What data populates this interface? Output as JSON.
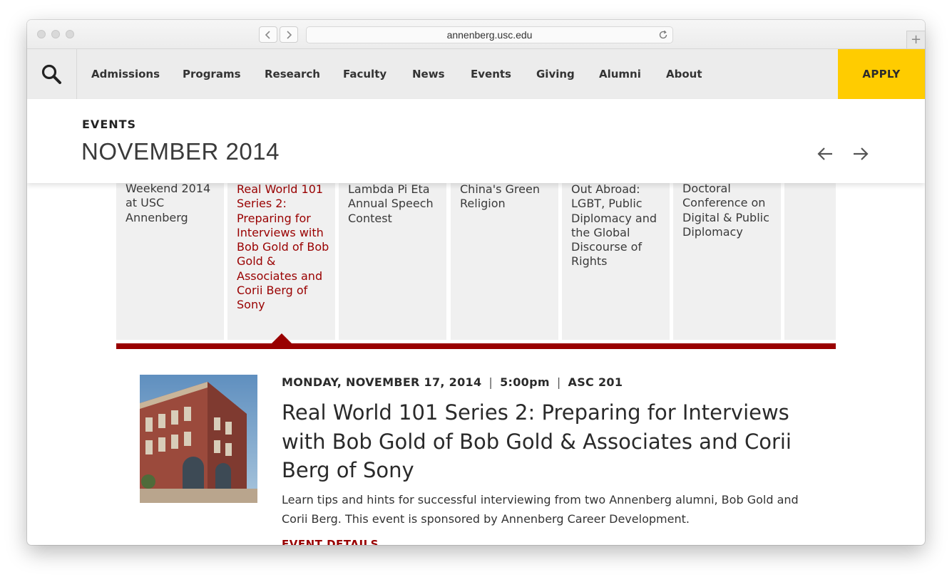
{
  "browser": {
    "url": "annenberg.usc.edu",
    "back_icon": "chevron-left-icon",
    "forward_icon": "chevron-right-icon",
    "reload_icon": "reload-icon",
    "new_tab_icon": "plus-icon"
  },
  "nav": {
    "search_icon": "search-icon",
    "items": [
      "Admissions",
      "Programs",
      "Research",
      "Faculty",
      "News",
      "Events",
      "Giving",
      "Alumni",
      "About"
    ],
    "apply_label": "APPLY",
    "apply_color": "#ffcc00"
  },
  "events_header": {
    "label": "EVENTS",
    "month": "NOVEMBER 2014",
    "prev_icon": "arrow-left-icon",
    "next_icon": "arrow-right-icon"
  },
  "cards": [
    {
      "title": "Weekend 2014 at USC Annenberg"
    },
    {
      "title": "Real World 101 Series 2: Preparing for Interviews with Bob Gold of Bob Gold & Associates and Corii Berg of Sony",
      "active": true
    },
    {
      "title": "Lambda Pi Eta Annual Speech Contest"
    },
    {
      "title": "China's Green Religion"
    },
    {
      "title": "Out Abroad: LGBT, Public Diplomacy and the Global Discourse of Rights"
    },
    {
      "title": "Doctoral Conference on Digital & Public Diplomacy"
    },
    {
      "title": ""
    }
  ],
  "accent_color": "#990000",
  "event": {
    "date": "MONDAY, NOVEMBER 17, 2014",
    "time": "5:00pm",
    "location": "ASC 201",
    "separator": "|",
    "title": "Real World 101 Series 2: Preparing for Interviews with Bob Gold of Bob Gold & Associates and Corii Berg of Sony",
    "description": "Learn tips and hints for successful interviewing from two Annenberg alumni, Bob Gold and Corii Berg. This event is sponsored by Annenberg Career Development.",
    "details_link": "EVENT DETAILS"
  }
}
